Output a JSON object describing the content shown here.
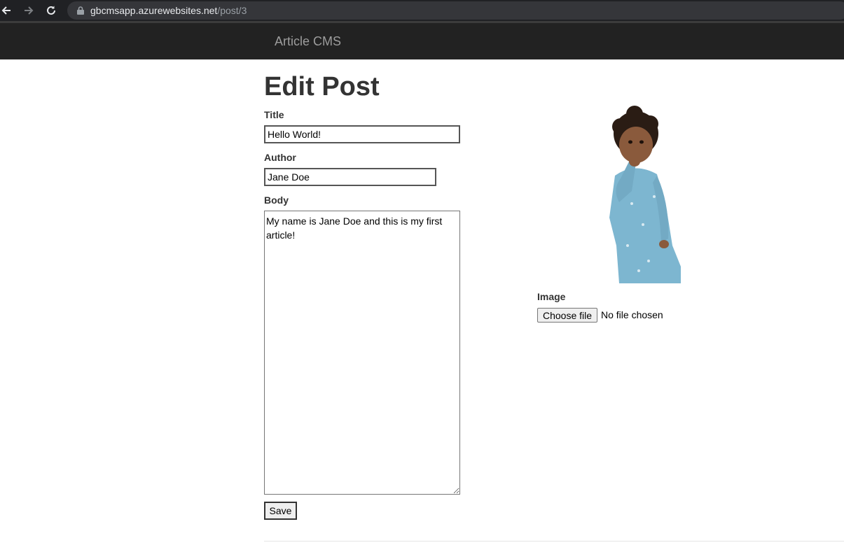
{
  "browser": {
    "url_host": "gbcmsapp.azurewebsites.net",
    "url_path": "/post/3",
    "icons": [
      "back-arrow-icon",
      "forward-arrow-icon",
      "reload-icon",
      "lock-icon"
    ]
  },
  "navbar": {
    "brand": "Article CMS",
    "background": "#222222",
    "brand_color": "#9d9d9d"
  },
  "page": {
    "title": "Edit Post"
  },
  "form": {
    "title_label": "Title",
    "title_value": "Hello World!",
    "author_label": "Author",
    "author_value": "Jane Doe",
    "body_label": "Body",
    "body_value": "My name is Jane Doe and this is my first article!",
    "image_label": "Image",
    "file_button": "Choose file",
    "file_status": "No file chosen",
    "save_label": "Save"
  }
}
